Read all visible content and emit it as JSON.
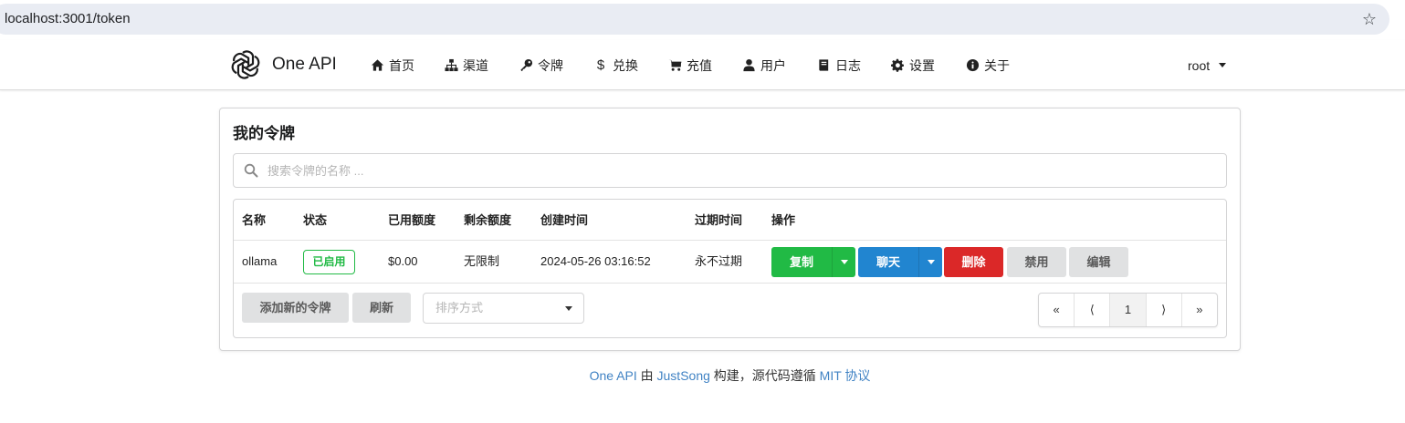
{
  "browser": {
    "url": "localhost:3001/token"
  },
  "header": {
    "brand": "One API",
    "nav": [
      {
        "label": "首页",
        "icon": "home-icon"
      },
      {
        "label": "渠道",
        "icon": "sitemap-icon"
      },
      {
        "label": "令牌",
        "icon": "key-icon"
      },
      {
        "label": "兑换",
        "icon": "dollar-icon"
      },
      {
        "label": "充值",
        "icon": "cart-icon"
      },
      {
        "label": "用户",
        "icon": "user-icon"
      },
      {
        "label": "日志",
        "icon": "book-icon"
      },
      {
        "label": "设置",
        "icon": "gear-icon"
      },
      {
        "label": "关于",
        "icon": "info-icon"
      }
    ],
    "user": "root"
  },
  "card": {
    "title": "我的令牌",
    "search_placeholder": "搜索令牌的名称 ..."
  },
  "table": {
    "headers": [
      "名称",
      "状态",
      "已用额度",
      "剩余额度",
      "创建时间",
      "过期时间",
      "操作"
    ],
    "rows": [
      {
        "name": "ollama",
        "status": "已启用",
        "used": "$0.00",
        "remaining": "无限制",
        "created": "2024-05-26 03:16:52",
        "expires": "永不过期"
      }
    ],
    "actions": {
      "copy": "复制",
      "chat": "聊天",
      "delete": "删除",
      "disable": "禁用",
      "edit": "编辑"
    }
  },
  "toolbar": {
    "add": "添加新的令牌",
    "refresh": "刷新",
    "sort_placeholder": "排序方式"
  },
  "pagination": {
    "first": "«",
    "prev": "⟨",
    "current": "1",
    "next": "⟩",
    "last": "»"
  },
  "footer": {
    "p1": "One API",
    "p2": " 由 ",
    "p3": "JustSong",
    "p4": " 构建，源代码遵循 ",
    "p5": "MIT 协议"
  },
  "colors": {
    "green": "#21ba45",
    "blue": "#2185d0",
    "red": "#db2828",
    "link": "#4183c4"
  }
}
